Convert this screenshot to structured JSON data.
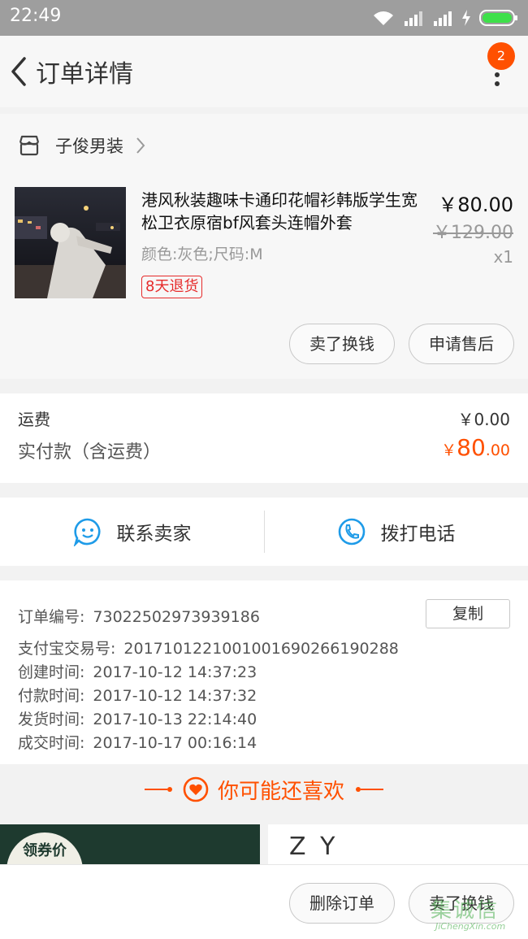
{
  "status_bar": {
    "time": "22:49"
  },
  "nav": {
    "title": "订单详情",
    "badge": "2"
  },
  "shop": {
    "name": "子俊男装"
  },
  "item": {
    "title": "港风秋装趣味卡通印花帽衫韩版学生宽松卫衣原宿bf风套头连帽外套",
    "spec": "颜色:灰色;尺码:M",
    "tag": "8天退货",
    "price": "￥80.00",
    "original_price": "￥129.00",
    "quantity": "x1",
    "btn_sell": "卖了换钱",
    "btn_after_sale": "申请售后"
  },
  "fees": {
    "shipping_label": "运费",
    "shipping_value": "￥0.00",
    "paid_label": "实付款（含运费）",
    "paid_symbol": "￥",
    "paid_int": "80",
    "paid_dec": ".00"
  },
  "contact": {
    "seller": "联系卖家",
    "call": "拨打电话"
  },
  "order_info": {
    "copy": "复制",
    "rows": [
      {
        "label": "订单编号:",
        "value": "73022502973939186"
      },
      {
        "label": "支付宝交易号:",
        "value": "2017101221001001690266190288"
      },
      {
        "label": "创建时间:",
        "value": "2017-10-12 14:37:23"
      },
      {
        "label": "付款时间:",
        "value": "2017-10-12 14:37:32"
      },
      {
        "label": "发货时间:",
        "value": "2017-10-13 22:14:40"
      },
      {
        "label": "成交时间:",
        "value": "2017-10-17 00:16:14"
      }
    ]
  },
  "recommend": {
    "title": "你可能还喜欢",
    "coupon": "领券价",
    "card2_text": "Z Y"
  },
  "bottom": {
    "delete": "删除订单",
    "sell": "卖了换钱"
  },
  "watermark": {
    "cn": "集诚信",
    "en": "JiChengXin.com"
  },
  "colors": {
    "accent": "#ff5000",
    "tag_red": "#e62b2b",
    "icon_blue": "#1e9be8"
  }
}
